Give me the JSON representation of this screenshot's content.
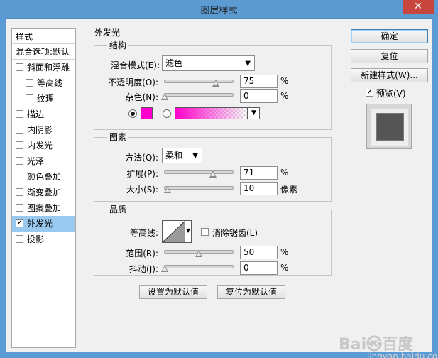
{
  "window": {
    "title": "图层样式",
    "close_glyph": "✕"
  },
  "stylelist": {
    "header": "样式",
    "blend_options": "混合选项:默认",
    "items": [
      {
        "label": "斜面和浮雕",
        "checked": false,
        "sub": false
      },
      {
        "label": "等高线",
        "checked": false,
        "sub": true
      },
      {
        "label": "纹理",
        "checked": false,
        "sub": true
      },
      {
        "label": "描边",
        "checked": false,
        "sub": false
      },
      {
        "label": "内阴影",
        "checked": false,
        "sub": false
      },
      {
        "label": "内发光",
        "checked": false,
        "sub": false
      },
      {
        "label": "光泽",
        "checked": false,
        "sub": false
      },
      {
        "label": "颜色叠加",
        "checked": false,
        "sub": false
      },
      {
        "label": "渐变叠加",
        "checked": false,
        "sub": false
      },
      {
        "label": "图案叠加",
        "checked": false,
        "sub": false
      },
      {
        "label": "外发光",
        "checked": true,
        "sub": false,
        "selected": true
      },
      {
        "label": "投影",
        "checked": false,
        "sub": false
      }
    ]
  },
  "outer_glow": {
    "title": "外发光",
    "structure": {
      "title": "结构",
      "blend_mode_label": "混合模式(E):",
      "blend_mode_value": "滤色",
      "opacity_label": "不透明度(O):",
      "opacity_value": "75",
      "opacity_unit": "%",
      "opacity_level": 0.75,
      "noise_label": "杂色(N):",
      "noise_value": "0",
      "noise_unit": "%",
      "noise_level": 0,
      "glow_color": "#ff00cc",
      "color_mode": "solid"
    },
    "elements": {
      "title": "图素",
      "method_label": "方法(Q):",
      "method_value": "柔和",
      "spread_label": "扩展(P):",
      "spread_value": "71",
      "spread_unit": "%",
      "spread_level": 0.71,
      "size_label": "大小(S):",
      "size_value": "10",
      "size_unit": "像素",
      "size_level": 0.04
    },
    "quality": {
      "title": "品质",
      "contour_label": "等高线:",
      "antialias_label": "消除锯齿(L)",
      "antialias_checked": false,
      "range_label": "范围(R):",
      "range_value": "50",
      "range_unit": "%",
      "range_level": 0.5,
      "jitter_label": "抖动(J):",
      "jitter_value": "0",
      "jitter_unit": "%",
      "jitter_level": 0
    },
    "set_default_label": "设置为默认值",
    "reset_default_label": "复位为默认值"
  },
  "actions": {
    "ok_label": "确定",
    "reset_label": "复位",
    "new_style_label": "新建样式(W)...",
    "preview_label": "预览(V)",
    "preview_checked": true
  },
  "watermark": {
    "brand": "Bai㉿百度",
    "sub": "jingyan.baidu.com"
  }
}
